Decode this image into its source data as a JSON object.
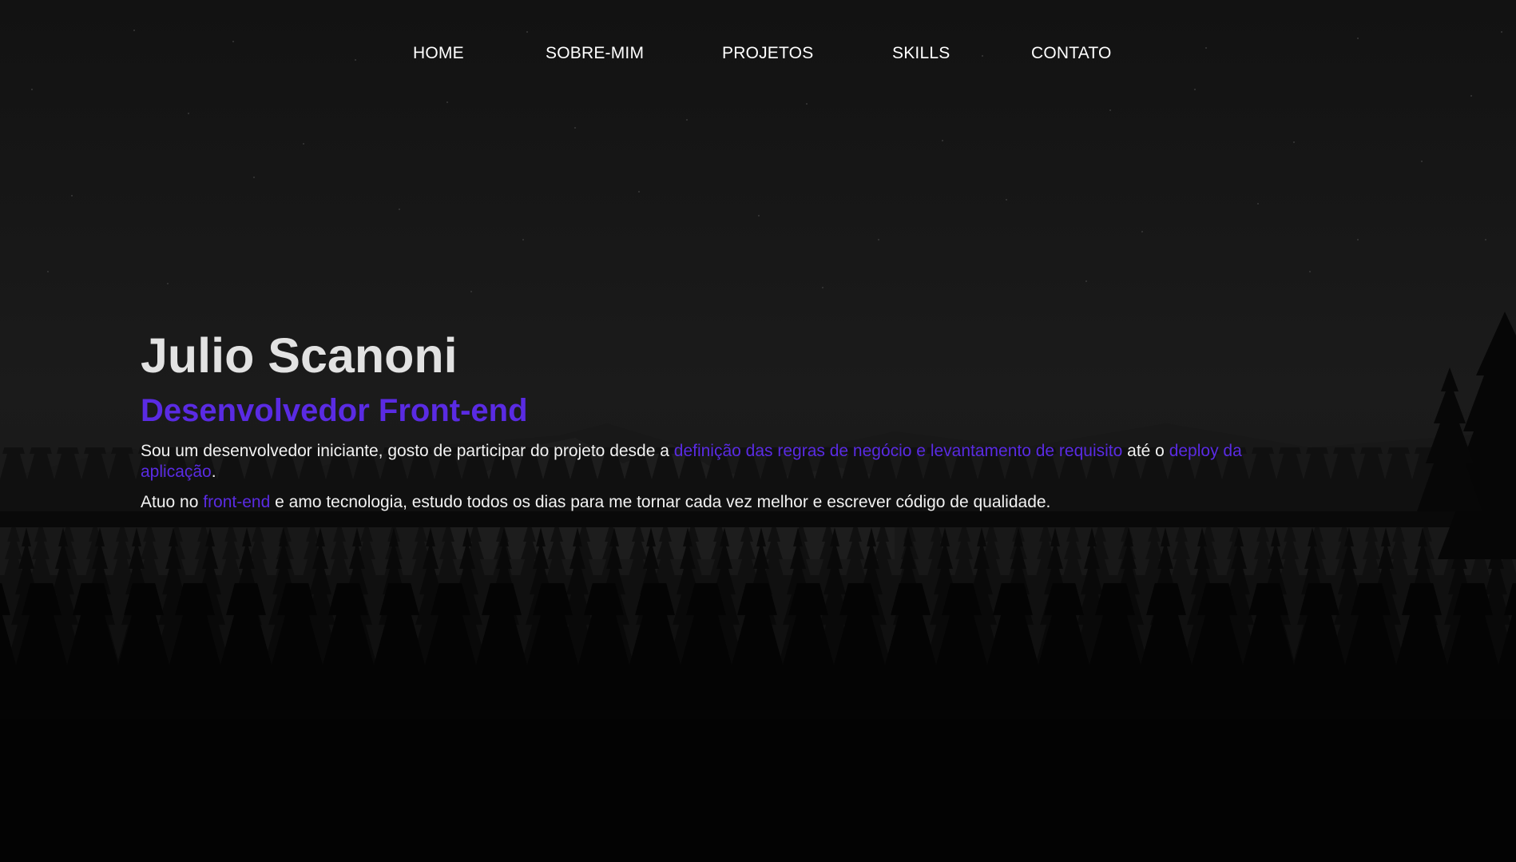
{
  "nav": {
    "items": [
      {
        "label": "HOME"
      },
      {
        "label": "SOBRE-MIM"
      },
      {
        "label": "PROJETOS"
      },
      {
        "label": "SKILLS"
      },
      {
        "label": "CONTATO"
      }
    ]
  },
  "hero": {
    "name": "Julio Scanoni",
    "role": "Desenvolvedor Front-end",
    "paragraph1": {
      "text_a": "Sou um desenvolvedor iniciante, gosto de participar do projeto desde a ",
      "highlight_a": "definição das regras de negócio e levantamento de requisito",
      "text_b": " até o ",
      "highlight_b": "deploy da aplicação",
      "text_c": "."
    },
    "paragraph2": {
      "text_a": "Atuo no ",
      "highlight_a": "front-end",
      "text_b": " e amo tecnologia, estudo todos os dias para me tornar cada vez melhor e escrever código de qualidade."
    }
  },
  "colors": {
    "accent": "#5a2be3",
    "background": "#141414",
    "text": "#f2f2f2"
  },
  "background": {
    "icon": "night-forest-mountains-stars"
  }
}
